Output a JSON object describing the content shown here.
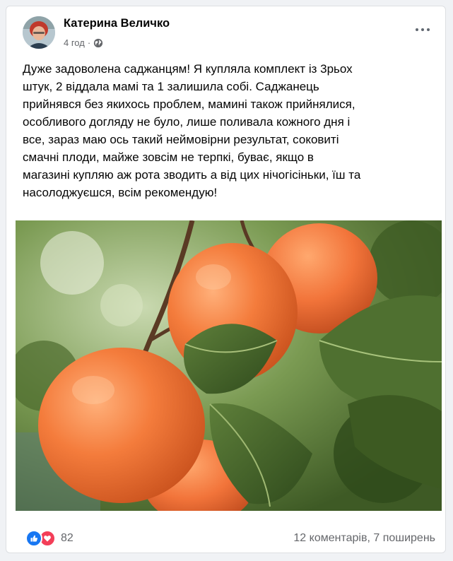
{
  "post": {
    "author": "Катерина Величко",
    "time": "4 год",
    "dot": "·",
    "privacy_icon": "globe-icon",
    "menu_icon": "more-dots-icon",
    "text": "Дуже задоволена саджанцям! Я купляла комплект із 3рьох\nштук, 2 віддала мамі та 1 залишила собі. Саджанець\nприйнявся без якихось проблем, мамині також прийнялися,\nособливого догляду не було, лише поливала кожного дня і\nвсе, зараз маю ось такий неймовірни результат, соковиті\nсмачні плоди, майже зовсім не терпкі, буває, якщо в\nмагазині купляю аж рота зводить а від цих нічогісіньки, їш та\nнасолоджуєшся, всім рекомендую!",
    "image_subject": "persimmons-on-branch"
  },
  "footer": {
    "reaction_icons": [
      "like-icon",
      "love-icon"
    ],
    "reaction_count": "82",
    "comments": "12 коментарів",
    "separator": ", ",
    "shares": "7 поширень"
  },
  "colors": {
    "like": "#1877f2",
    "love": "#f33e58",
    "secondary_text": "#65676b"
  }
}
